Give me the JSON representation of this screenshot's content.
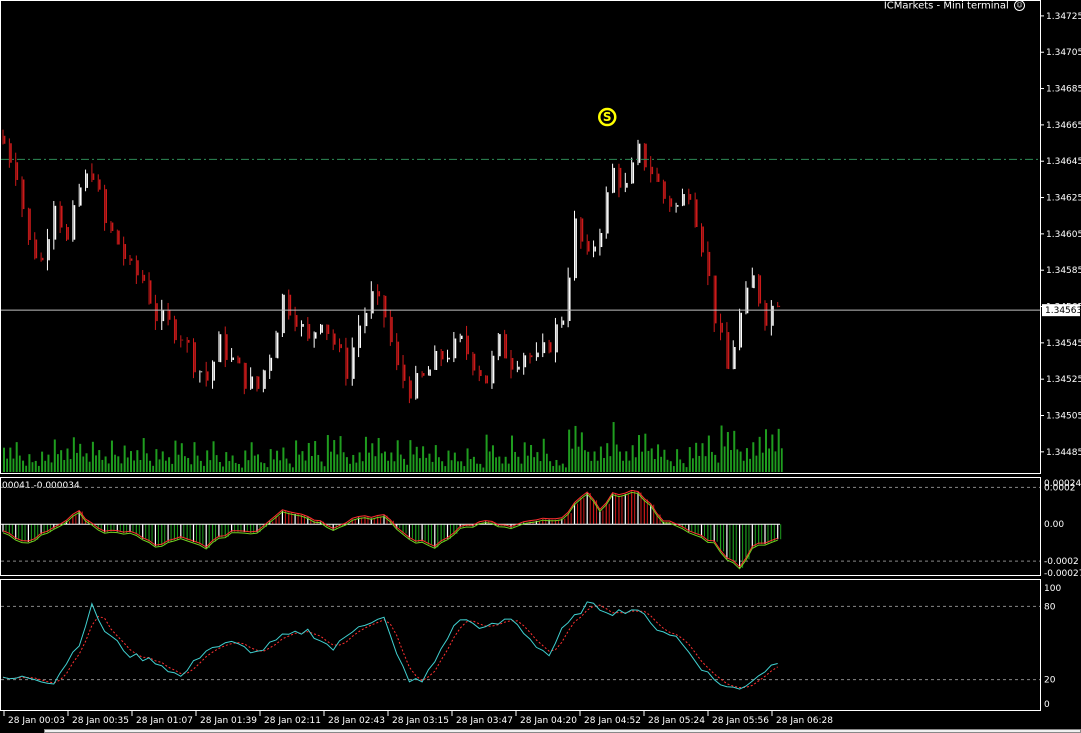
{
  "window": {
    "title": "ICMarkets - Mini terminal",
    "title_icon": "smiley-icon"
  },
  "colors": {
    "background": "#000000",
    "bull_bar": "#ffffff",
    "bear_bar": "#cc1a1a",
    "volume": "#1f9d1f",
    "osc_positive": "#cc1a1a",
    "osc_negative": "#1f9d1f",
    "osc_line_red": "#ff3030",
    "osc_line_green": "#70d020",
    "stoch_main": "#40d0d0",
    "stoch_signal": "#ff3030",
    "level_line": "#2e8b57",
    "signal_marker": "#ffff00"
  },
  "price_axis": {
    "labels": [
      "1.34725",
      "1.34705",
      "1.34685",
      "1.34665",
      "1.34645",
      "1.34625",
      "1.34605",
      "1.34585",
      "1.34565",
      "1.34545",
      "1.34525",
      "1.34505",
      "1.34485"
    ],
    "current_price": "1.34563",
    "min": 1.34475,
    "max": 1.34731,
    "level_line_price": 1.34646
  },
  "signal_marker": {
    "text": "S",
    "time_index": 95,
    "price": 1.34655
  },
  "time_axis": {
    "labels": [
      "28 Jan 00:03",
      "28 Jan 00:35",
      "28 Jan 01:07",
      "28 Jan 01:39",
      "28 Jan 02:11",
      "28 Jan 02:43",
      "28 Jan 03:15",
      "28 Jan 03:47",
      "28 Jan 04:20",
      "28 Jan 04:52",
      "28 Jan 05:24",
      "28 Jan 05:56",
      "28 Jan 06:28"
    ]
  },
  "oscillator": {
    "header": "00041 -0.000034",
    "levels": [
      "0.00024",
      "0.0002",
      "0.00",
      "-0.0002",
      "-0.00027"
    ],
    "min": -0.00027,
    "max": 0.00024
  },
  "stochastic": {
    "levels": [
      "100",
      "80",
      "20",
      "0"
    ]
  },
  "chart_data": {
    "type": "candlestick",
    "x_unit": "bar index (time labels every 32 minutes)",
    "close_anchors": [
      [
        0,
        1.34655
      ],
      [
        2,
        1.3464
      ],
      [
        4,
        1.346
      ],
      [
        6,
        1.3459
      ],
      [
        8,
        1.34625
      ],
      [
        10,
        1.346
      ],
      [
        12,
        1.3463
      ],
      [
        14,
        1.3464
      ],
      [
        16,
        1.3461
      ],
      [
        18,
        1.346
      ],
      [
        20,
        1.34585
      ],
      [
        22,
        1.3458
      ],
      [
        24,
        1.3456
      ],
      [
        26,
        1.34555
      ],
      [
        28,
        1.3455
      ],
      [
        30,
        1.34535
      ],
      [
        32,
        1.34525
      ],
      [
        34,
        1.34545
      ],
      [
        36,
        1.34535
      ],
      [
        38,
        1.34525
      ],
      [
        40,
        1.3452
      ],
      [
        42,
        1.3454
      ],
      [
        44,
        1.3457
      ],
      [
        46,
        1.3456
      ],
      [
        48,
        1.34545
      ],
      [
        50,
        1.3456
      ],
      [
        52,
        1.34545
      ],
      [
        54,
        1.3453
      ],
      [
        56,
        1.34555
      ],
      [
        58,
        1.3457
      ],
      [
        60,
        1.3456
      ],
      [
        62,
        1.3453
      ],
      [
        64,
        1.3452
      ],
      [
        66,
        1.34525
      ],
      [
        68,
        1.34535
      ],
      [
        70,
        1.3454
      ],
      [
        72,
        1.34545
      ],
      [
        74,
        1.34535
      ],
      [
        76,
        1.34525
      ],
      [
        78,
        1.34545
      ],
      [
        80,
        1.34535
      ],
      [
        82,
        1.3454
      ],
      [
        84,
        1.34535
      ],
      [
        86,
        1.34545
      ],
      [
        88,
        1.3456
      ],
      [
        90,
        1.3461
      ],
      [
        92,
        1.3459
      ],
      [
        94,
        1.3461
      ],
      [
        96,
        1.3464
      ],
      [
        98,
        1.3463
      ],
      [
        100,
        1.3465
      ],
      [
        102,
        1.3464
      ],
      [
        104,
        1.34625
      ],
      [
        106,
        1.3462
      ],
      [
        108,
        1.3463
      ],
      [
        110,
        1.346
      ],
      [
        112,
        1.3456
      ],
      [
        114,
        1.3453
      ],
      [
        116,
        1.3456
      ],
      [
        118,
        1.3458
      ],
      [
        120,
        1.3456
      ],
      [
        122,
        1.3457
      ]
    ],
    "oscillator_anchors": [
      [
        0,
        -5e-05
      ],
      [
        4,
        -0.0001
      ],
      [
        8,
        -2e-05
      ],
      [
        12,
        6e-05
      ],
      [
        16,
        -5e-05
      ],
      [
        20,
        -4e-05
      ],
      [
        24,
        -0.00012
      ],
      [
        28,
        -8e-05
      ],
      [
        32,
        -0.00012
      ],
      [
        36,
        -4e-05
      ],
      [
        40,
        -4e-05
      ],
      [
        44,
        8e-05
      ],
      [
        48,
        4e-05
      ],
      [
        52,
        -2e-05
      ],
      [
        56,
        4e-05
      ],
      [
        60,
        4e-05
      ],
      [
        64,
        -8e-05
      ],
      [
        68,
        -0.00012
      ],
      [
        72,
        -2e-05
      ],
      [
        76,
        1e-05
      ],
      [
        80,
        -2e-05
      ],
      [
        84,
        2e-05
      ],
      [
        88,
        2e-05
      ],
      [
        90,
        0.00012
      ],
      [
        92,
        0.00016
      ],
      [
        94,
        8e-05
      ],
      [
        96,
        0.00016
      ],
      [
        98,
        0.00016
      ],
      [
        100,
        0.00018
      ],
      [
        102,
        0.0001
      ],
      [
        104,
        2e-05
      ],
      [
        108,
        -4e-05
      ],
      [
        112,
        -0.0001
      ],
      [
        114,
        -0.00018
      ],
      [
        116,
        -0.00024
      ],
      [
        118,
        -0.00012
      ],
      [
        122,
        -8e-05
      ]
    ],
    "stochastic_anchors": [
      [
        0,
        20
      ],
      [
        4,
        22
      ],
      [
        8,
        18
      ],
      [
        12,
        50
      ],
      [
        14,
        80
      ],
      [
        16,
        60
      ],
      [
        20,
        40
      ],
      [
        24,
        35
      ],
      [
        28,
        22
      ],
      [
        32,
        45
      ],
      [
        36,
        50
      ],
      [
        40,
        42
      ],
      [
        44,
        55
      ],
      [
        48,
        60
      ],
      [
        52,
        45
      ],
      [
        56,
        65
      ],
      [
        60,
        70
      ],
      [
        62,
        40
      ],
      [
        64,
        20
      ],
      [
        66,
        18
      ],
      [
        68,
        35
      ],
      [
        70,
        55
      ],
      [
        72,
        70
      ],
      [
        76,
        62
      ],
      [
        80,
        70
      ],
      [
        84,
        48
      ],
      [
        86,
        40
      ],
      [
        88,
        60
      ],
      [
        92,
        82
      ],
      [
        96,
        75
      ],
      [
        100,
        78
      ],
      [
        102,
        65
      ],
      [
        106,
        55
      ],
      [
        110,
        30
      ],
      [
        112,
        20
      ],
      [
        114,
        14
      ],
      [
        116,
        12
      ],
      [
        118,
        20
      ],
      [
        122,
        35
      ]
    ],
    "bar_count": 123,
    "title": ""
  }
}
